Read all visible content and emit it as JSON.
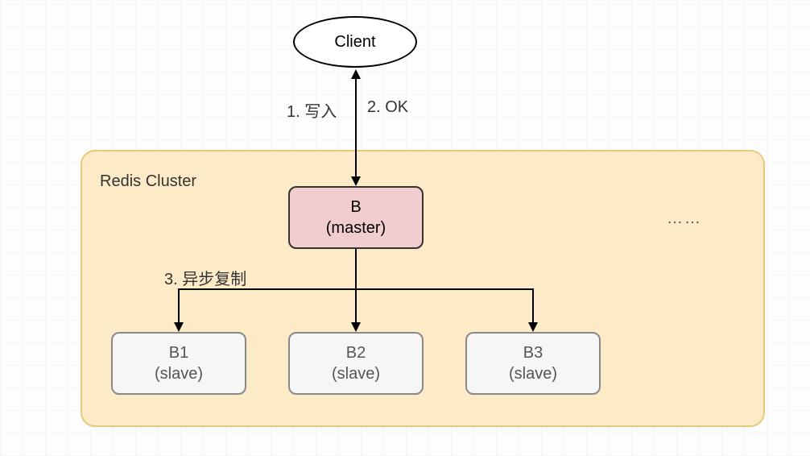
{
  "client": {
    "label": "Client"
  },
  "cluster": {
    "title": "Redis Cluster"
  },
  "master": {
    "name": "B",
    "role": "(master)"
  },
  "slaves": {
    "b1": {
      "name": "B1",
      "role": "(slave)"
    },
    "b2": {
      "name": "B2",
      "role": "(slave)"
    },
    "b3": {
      "name": "B3",
      "role": "(slave)"
    }
  },
  "arrows": {
    "write": "1. 写入",
    "ok": "2. OK",
    "replicate": "3. 异步复制"
  },
  "ellipsis": "……"
}
